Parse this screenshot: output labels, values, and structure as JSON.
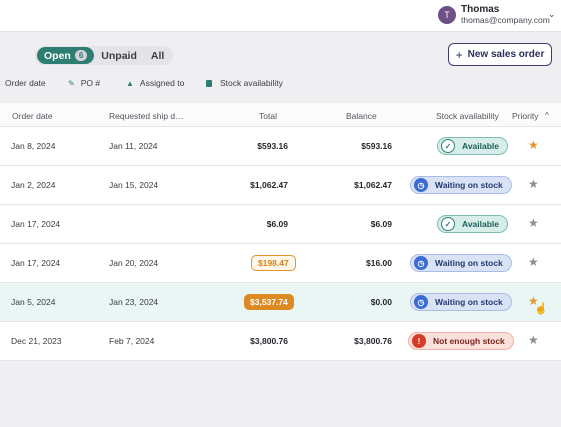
{
  "user": {
    "initial": "T",
    "name": "Thomas",
    "email": "thomas@company.com",
    "chevron": "⌄"
  },
  "filters": [
    {
      "label": "Open",
      "count": "6",
      "active": true
    },
    {
      "label": "Unpaid"
    },
    {
      "label": "All"
    }
  ],
  "new_order": {
    "label": "New sales order",
    "icon": "plus-icon"
  },
  "quick_filters": {
    "order_date": "Order date",
    "po": "PO #",
    "assigned": "Assigned to",
    "stock": "Stock availability"
  },
  "columns": {
    "order_date": "Order date",
    "ship_date": "Requested ship d…",
    "total": "Total",
    "balance": "Balance",
    "stock": "Stock availability",
    "priority": "Priority",
    "sort_icon": "^"
  },
  "rows": [
    {
      "order_date": "Jan 8, 2024",
      "ship_date": "Jan 11, 2024",
      "total": "$593.16",
      "balance": "$593.16",
      "stock": "Available",
      "priority": true
    },
    {
      "order_date": "Jan 2, 2024",
      "ship_date": "Jan 15, 2024",
      "total": "$1,062.47",
      "balance": "$1,062.47",
      "stock": "Waiting on stock",
      "priority": false
    },
    {
      "order_date": "Jan 17, 2024",
      "ship_date": "",
      "total": "$6.09",
      "balance": "$6.09",
      "stock": "Available",
      "priority": false
    },
    {
      "order_date": "Jan 17, 2024",
      "ship_date": "Jan 20, 2024",
      "total": "$198.47",
      "balance": "$16.00",
      "stock": "Waiting on stock",
      "priority": false
    },
    {
      "order_date": "Jan 5, 2024",
      "ship_date": "Jan 23, 2024",
      "total": "$3,537.74",
      "balance": "$0.00",
      "stock": "Waiting on stock",
      "priority": true
    },
    {
      "order_date": "Dec 21, 2023",
      "ship_date": "Feb 7, 2024",
      "total": "$3,800.76",
      "balance": "$3,800.76",
      "stock": "Not enough stock",
      "priority": false
    }
  ],
  "colors": {
    "accent": "#2e7d73",
    "star_on": "#e39a2c",
    "navy": "#3a3f72",
    "warning": "#dd8a22"
  }
}
